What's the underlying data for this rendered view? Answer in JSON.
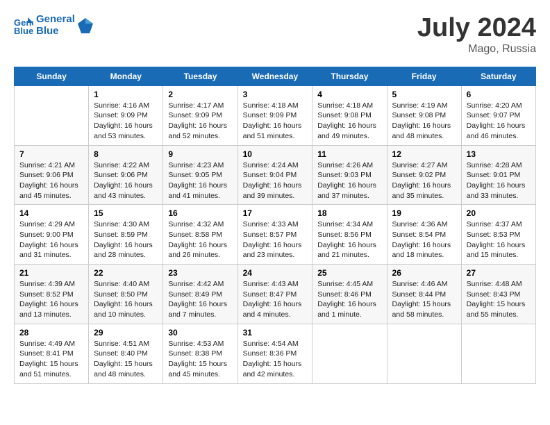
{
  "header": {
    "logo_line1": "General",
    "logo_line2": "Blue",
    "month_year": "July 2024",
    "location": "Mago, Russia"
  },
  "weekdays": [
    "Sunday",
    "Monday",
    "Tuesday",
    "Wednesday",
    "Thursday",
    "Friday",
    "Saturday"
  ],
  "rows": [
    [
      {
        "day": "",
        "text": ""
      },
      {
        "day": "1",
        "text": "Sunrise: 4:16 AM\nSunset: 9:09 PM\nDaylight: 16 hours\nand 53 minutes."
      },
      {
        "day": "2",
        "text": "Sunrise: 4:17 AM\nSunset: 9:09 PM\nDaylight: 16 hours\nand 52 minutes."
      },
      {
        "day": "3",
        "text": "Sunrise: 4:18 AM\nSunset: 9:09 PM\nDaylight: 16 hours\nand 51 minutes."
      },
      {
        "day": "4",
        "text": "Sunrise: 4:18 AM\nSunset: 9:08 PM\nDaylight: 16 hours\nand 49 minutes."
      },
      {
        "day": "5",
        "text": "Sunrise: 4:19 AM\nSunset: 9:08 PM\nDaylight: 16 hours\nand 48 minutes."
      },
      {
        "day": "6",
        "text": "Sunrise: 4:20 AM\nSunset: 9:07 PM\nDaylight: 16 hours\nand 46 minutes."
      }
    ],
    [
      {
        "day": "7",
        "text": "Sunrise: 4:21 AM\nSunset: 9:06 PM\nDaylight: 16 hours\nand 45 minutes."
      },
      {
        "day": "8",
        "text": "Sunrise: 4:22 AM\nSunset: 9:06 PM\nDaylight: 16 hours\nand 43 minutes."
      },
      {
        "day": "9",
        "text": "Sunrise: 4:23 AM\nSunset: 9:05 PM\nDaylight: 16 hours\nand 41 minutes."
      },
      {
        "day": "10",
        "text": "Sunrise: 4:24 AM\nSunset: 9:04 PM\nDaylight: 16 hours\nand 39 minutes."
      },
      {
        "day": "11",
        "text": "Sunrise: 4:26 AM\nSunset: 9:03 PM\nDaylight: 16 hours\nand 37 minutes."
      },
      {
        "day": "12",
        "text": "Sunrise: 4:27 AM\nSunset: 9:02 PM\nDaylight: 16 hours\nand 35 minutes."
      },
      {
        "day": "13",
        "text": "Sunrise: 4:28 AM\nSunset: 9:01 PM\nDaylight: 16 hours\nand 33 minutes."
      }
    ],
    [
      {
        "day": "14",
        "text": "Sunrise: 4:29 AM\nSunset: 9:00 PM\nDaylight: 16 hours\nand 31 minutes."
      },
      {
        "day": "15",
        "text": "Sunrise: 4:30 AM\nSunset: 8:59 PM\nDaylight: 16 hours\nand 28 minutes."
      },
      {
        "day": "16",
        "text": "Sunrise: 4:32 AM\nSunset: 8:58 PM\nDaylight: 16 hours\nand 26 minutes."
      },
      {
        "day": "17",
        "text": "Sunrise: 4:33 AM\nSunset: 8:57 PM\nDaylight: 16 hours\nand 23 minutes."
      },
      {
        "day": "18",
        "text": "Sunrise: 4:34 AM\nSunset: 8:56 PM\nDaylight: 16 hours\nand 21 minutes."
      },
      {
        "day": "19",
        "text": "Sunrise: 4:36 AM\nSunset: 8:54 PM\nDaylight: 16 hours\nand 18 minutes."
      },
      {
        "day": "20",
        "text": "Sunrise: 4:37 AM\nSunset: 8:53 PM\nDaylight: 16 hours\nand 15 minutes."
      }
    ],
    [
      {
        "day": "21",
        "text": "Sunrise: 4:39 AM\nSunset: 8:52 PM\nDaylight: 16 hours\nand 13 minutes."
      },
      {
        "day": "22",
        "text": "Sunrise: 4:40 AM\nSunset: 8:50 PM\nDaylight: 16 hours\nand 10 minutes."
      },
      {
        "day": "23",
        "text": "Sunrise: 4:42 AM\nSunset: 8:49 PM\nDaylight: 16 hours\nand 7 minutes."
      },
      {
        "day": "24",
        "text": "Sunrise: 4:43 AM\nSunset: 8:47 PM\nDaylight: 16 hours\nand 4 minutes."
      },
      {
        "day": "25",
        "text": "Sunrise: 4:45 AM\nSunset: 8:46 PM\nDaylight: 16 hours\nand 1 minute."
      },
      {
        "day": "26",
        "text": "Sunrise: 4:46 AM\nSunset: 8:44 PM\nDaylight: 15 hours\nand 58 minutes."
      },
      {
        "day": "27",
        "text": "Sunrise: 4:48 AM\nSunset: 8:43 PM\nDaylight: 15 hours\nand 55 minutes."
      }
    ],
    [
      {
        "day": "28",
        "text": "Sunrise: 4:49 AM\nSunset: 8:41 PM\nDaylight: 15 hours\nand 51 minutes."
      },
      {
        "day": "29",
        "text": "Sunrise: 4:51 AM\nSunset: 8:40 PM\nDaylight: 15 hours\nand 48 minutes."
      },
      {
        "day": "30",
        "text": "Sunrise: 4:53 AM\nSunset: 8:38 PM\nDaylight: 15 hours\nand 45 minutes."
      },
      {
        "day": "31",
        "text": "Sunrise: 4:54 AM\nSunset: 8:36 PM\nDaylight: 15 hours\nand 42 minutes."
      },
      {
        "day": "",
        "text": ""
      },
      {
        "day": "",
        "text": ""
      },
      {
        "day": "",
        "text": ""
      }
    ]
  ]
}
